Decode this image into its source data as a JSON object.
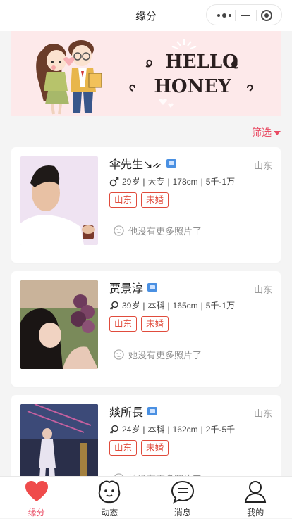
{
  "header": {
    "title": "缘分"
  },
  "banner": {
    "line1": "HELLO",
    "line2": "HONEY"
  },
  "filter": {
    "label": "筛选"
  },
  "cards": [
    {
      "name": "伞先生↘ᨀ",
      "region": "山东",
      "age": "29岁",
      "education": "大专",
      "height": "178cm",
      "income": "5千-1万",
      "tags": [
        "山东",
        "未婚"
      ],
      "more_photos_text": "他没有更多照片了"
    },
    {
      "name": "贾景淳",
      "region": "山东",
      "age": "39岁",
      "education": "本科",
      "height": "165cm",
      "income": "5千-1万",
      "tags": [
        "山东",
        "未婚"
      ],
      "more_photos_text": "她没有更多照片了"
    },
    {
      "name": "燚所長",
      "region": "山东",
      "age": "24岁",
      "education": "本科",
      "height": "162cm",
      "income": "2千-5千",
      "tags": [
        "山东",
        "未婚"
      ],
      "more_photos_text": "她没有更多照片了"
    }
  ],
  "tabbar": [
    {
      "label": "缘分",
      "active": true
    },
    {
      "label": "动态",
      "active": false
    },
    {
      "label": "消息",
      "active": false
    },
    {
      "label": "我的",
      "active": false
    }
  ],
  "colors": {
    "accent": "#e94b63",
    "tag": "#e04b3c",
    "banner_bg": "#fde9ea"
  }
}
